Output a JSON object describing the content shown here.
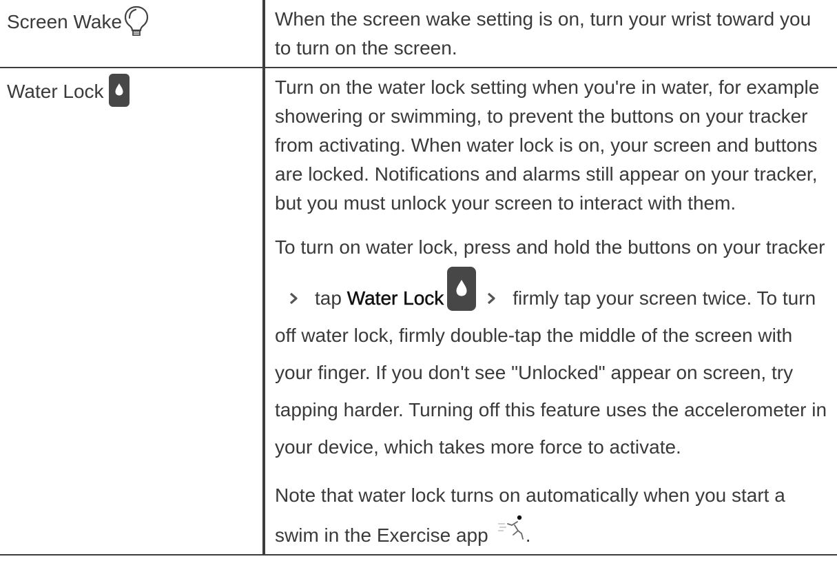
{
  "rows": [
    {
      "name": "Screen Wake",
      "icon": "lightbulb-icon",
      "paragraphs": [
        "When the screen wake setting is on, turn your wrist toward you to turn on the screen."
      ]
    },
    {
      "name": "Water Lock",
      "icon": "water-drop-icon",
      "paragraph1": "Turn on the water lock setting when you're in water, for example showering or swimming, to prevent the buttons on your tracker from activating. When water lock is on, your screen and buttons are locked. Notifications and alarms still appear on your tracker, but you must unlock your screen to interact with them.",
      "paragraph2": {
        "part1": "To turn on water lock, press and hold the buttons on your tracker",
        "part2": "tap",
        "bold": "Water Lock",
        "part3": "firmly tap your screen twice. To turn off water lock, firmly double-tap the middle of the screen with your finger. If you don't see \"Unlocked\" appear on screen, try tapping harder. Turning off this feature uses the accelerometer in your device, which takes more force to activate."
      },
      "paragraph3": {
        "text": "Note that water lock turns on automatically when you start a swim in the Exercise app",
        "end": "."
      }
    }
  ],
  "colors": {
    "border": "#3d3d3d",
    "text": "#3a3a3a",
    "icon_dark": "#444444"
  }
}
